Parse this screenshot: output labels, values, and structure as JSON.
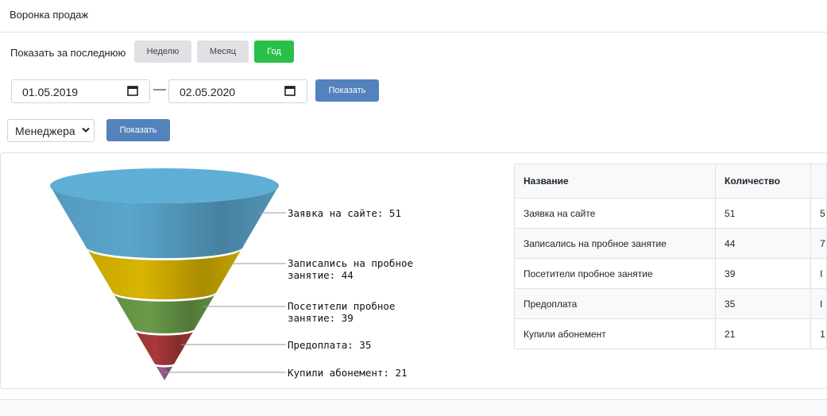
{
  "page": {
    "title": "Воронка продаж"
  },
  "filters": {
    "period_label": "Показать за последнюю",
    "period_buttons": [
      "Неделю",
      "Месяц",
      "Год"
    ],
    "active_period": "Год",
    "date_from": "01.05.2019",
    "date_to": "02.05.2020",
    "date_separator": "—",
    "show_label": "Показать",
    "manager_select": "Менеджера",
    "manager_show_label": "Показать"
  },
  "colors": {
    "green": "#28c04a",
    "blue": "#5382bd"
  },
  "table": {
    "headers": [
      "Название",
      "Количество"
    ],
    "rows": [
      [
        "Заявка на сайте",
        "51"
      ],
      [
        "Записались на пробное занятие",
        "44"
      ],
      [
        "Посетители пробное занятие",
        "39"
      ],
      [
        "Предоплата",
        "35"
      ],
      [
        "Купили абонемент",
        "21"
      ]
    ],
    "third_col_partial": [
      "5",
      "7",
      "I",
      "I",
      "1"
    ]
  },
  "chart_data": {
    "type": "funnel",
    "categories": [
      "Заявка на сайте",
      "Записались на пробное занятие",
      "Посетители пробное занятие",
      "Предоплата",
      "Купили абонемент"
    ],
    "values": [
      51,
      44,
      39,
      35,
      21
    ],
    "labels": [
      [
        "Заявка на сайте: 51"
      ],
      [
        "Записались на пробное",
        "занятие: 44"
      ],
      [
        "Посетители пробное",
        "занятие: 39"
      ],
      [
        "Предоплата: 35"
      ],
      [
        "Купили абонемент: 21"
      ]
    ],
    "colors": [
      "#5aa6cc",
      "#d9b400",
      "#6a9a48",
      "#a8383b",
      "#9d5d8e"
    ]
  }
}
